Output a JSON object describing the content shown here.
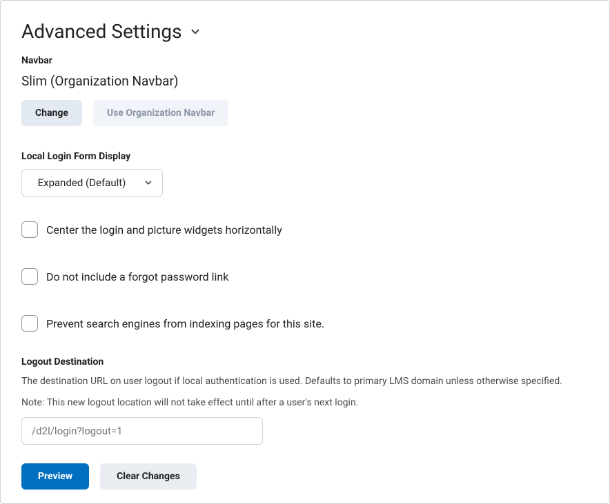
{
  "heading": "Advanced Settings",
  "navbar": {
    "label": "Navbar",
    "value": "Slim (Organization Navbar)",
    "change_label": "Change",
    "use_org_label": "Use Organization Navbar"
  },
  "login_form": {
    "label": "Local Login Form Display",
    "selected": "Expanded (Default)"
  },
  "checkboxes": {
    "center_widgets": "Center the login and picture widgets horizontally",
    "no_forgot_password": "Do not include a forgot password link",
    "prevent_indexing": "Prevent search engines from indexing pages for this site."
  },
  "logout": {
    "label": "Logout Destination",
    "desc1": "The destination URL on user logout if local authentication is used. Defaults to primary LMS domain unless otherwise specified.",
    "desc2": "Note: This new logout location will not take effect until after a user's next login.",
    "value": "/d2l/login?logout=1"
  },
  "footer": {
    "preview": "Preview",
    "clear": "Clear Changes"
  }
}
